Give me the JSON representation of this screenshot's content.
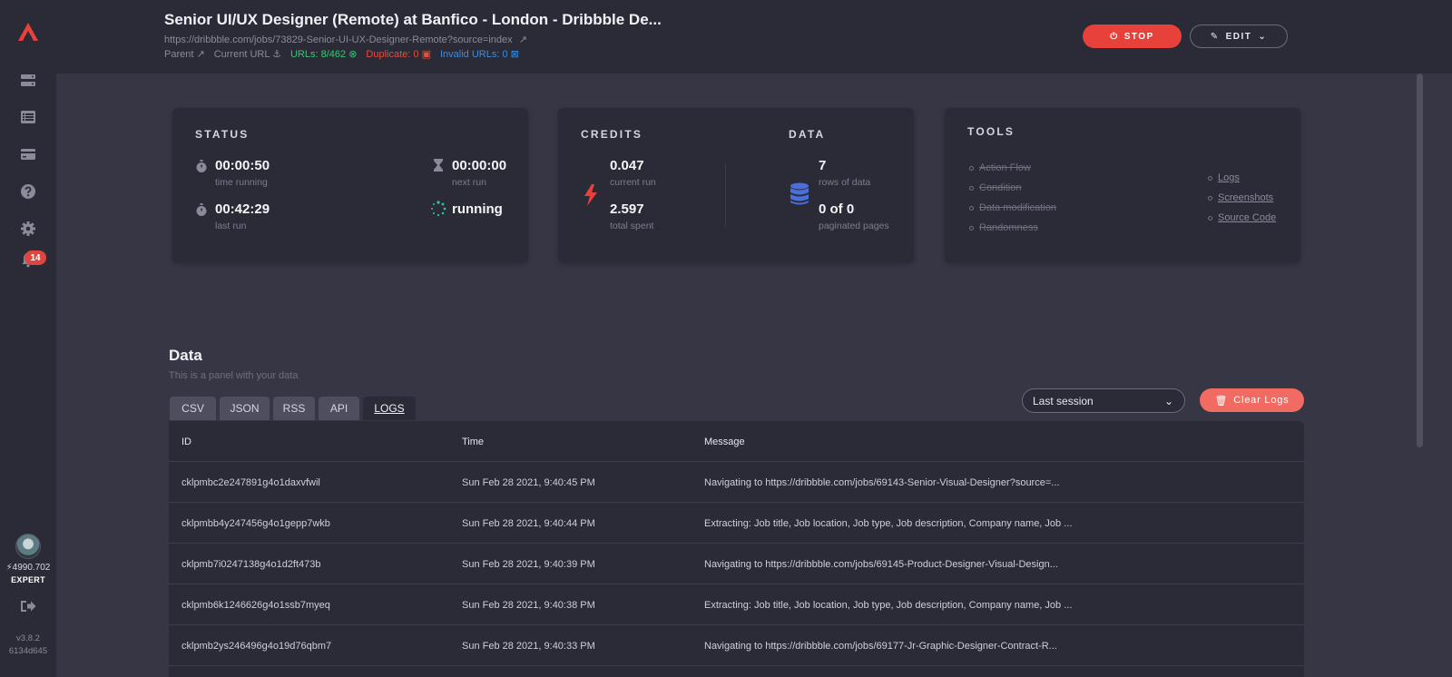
{
  "header": {
    "title": "Senior UI/UX Designer (Remote) at Banfico - London - Dribbble De...",
    "url": "https://dribbble.com/jobs/73829-Senior-UI-UX-Designer-Remote?source=index",
    "parent_label": "Parent",
    "current_url_label": "Current URL",
    "urls_label": "URLs: 8/462",
    "duplicate_label": "Duplicate: 0",
    "invalid_label": "Invalid URLs: 0",
    "stop_label": "STOP",
    "edit_label": "EDIT"
  },
  "sidebar": {
    "notifications_count": "14",
    "credits": "4990.702",
    "level": "EXPERT",
    "version": "v3.8.2",
    "build": "6134d645",
    "icons": [
      "servers-icon",
      "list-icon",
      "card-icon",
      "help-icon",
      "gear-icon",
      "bell-icon"
    ]
  },
  "status": {
    "title": "STATUS",
    "time_running": "00:00:50",
    "time_running_label": "time running",
    "next_run": "00:00:00",
    "next_run_label": "next run",
    "last_run": "00:42:29",
    "last_run_label": "last run",
    "state": "running"
  },
  "credits": {
    "title": "CREDITS",
    "current_run": "0.047",
    "current_run_label": "current run",
    "total_spent": "2.597",
    "total_spent_label": "total spent"
  },
  "data_card": {
    "title": "DATA",
    "rows": "7",
    "rows_label": "rows of data",
    "pages": "0 of 0",
    "pages_label": "paginated pages"
  },
  "tools": {
    "title": "TOOLS",
    "left": [
      "Action Flow",
      "Condition",
      "Data modification",
      "Randomness"
    ],
    "right": [
      "Logs",
      "Screenshots",
      "Source Code"
    ]
  },
  "data_section": {
    "title": "Data",
    "subtitle": "This is a panel with your data",
    "tabs": [
      "CSV",
      "JSON",
      "RSS",
      "API",
      "LOGS"
    ],
    "active_tab": "LOGS",
    "session_select": "Last session",
    "clear_label": "Clear Logs"
  },
  "logs": {
    "columns": [
      "ID",
      "Time",
      "Message"
    ],
    "rows": [
      {
        "id": "cklpmbc2e247891g4o1daxvfwil",
        "time": "Sun Feb 28 2021, 9:40:45 PM",
        "message": "Navigating to https://dribbble.com/jobs/69143-Senior-Visual-Designer?source=..."
      },
      {
        "id": "cklpmbb4y247456g4o1gepp7wkb",
        "time": "Sun Feb 28 2021, 9:40:44 PM",
        "message": "Extracting: Job title, Job location, Job type, Job description, Company name, Job ..."
      },
      {
        "id": "cklpmb7i0247138g4o1d2ft473b",
        "time": "Sun Feb 28 2021, 9:40:39 PM",
        "message": "Navigating to https://dribbble.com/jobs/69145-Product-Designer-Visual-Design..."
      },
      {
        "id": "cklpmb6k1246626g4o1ssb7myeq",
        "time": "Sun Feb 28 2021, 9:40:38 PM",
        "message": "Extracting: Job title, Job location, Job type, Job description, Company name, Job ..."
      },
      {
        "id": "cklpmb2ys246496g4o19d76qbm7",
        "time": "Sun Feb 28 2021, 9:40:33 PM",
        "message": "Navigating to https://dribbble.com/jobs/69177-Jr-Graphic-Designer-Contract-R..."
      }
    ]
  },
  "colors": {
    "accent_red": "#e8413a",
    "clear_red": "#f26b63",
    "green": "#2ecc71",
    "blue": "#3a8dde",
    "db_blue": "#4a6fd8",
    "spinner": "#2ecc9a"
  }
}
